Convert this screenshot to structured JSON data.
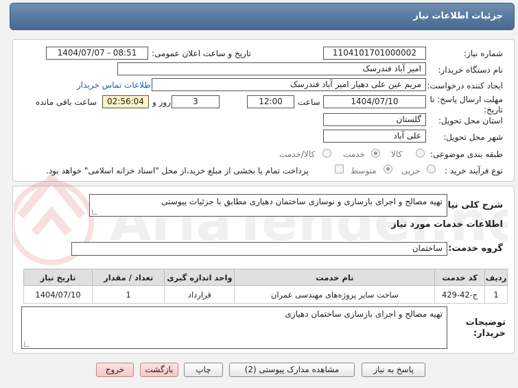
{
  "header": {
    "title": "جزئیات اطلاعات نیاز"
  },
  "form": {
    "need_number_label": "شماره نیاز:",
    "need_number": "1104101701000002",
    "announce_label": "تاریخ و ساعت اعلان عمومی:",
    "announce_value": "1404/07/07 - 08:51",
    "buyer_org_label": "نام دستگاه خریدار:",
    "buyer_org": "امیر آباد فندرسک",
    "creator_label": "ایجاد کننده درخواست:",
    "creator": "مریم عین علی دهیار امیر آباد فندرسک",
    "contact_link": "اطلاعات تماس خریدار",
    "deadline_label": "مهلت ارسال پاسخ: تا تاریخ:",
    "deadline_date": "1404/07/10",
    "time_label": "ساعت",
    "deadline_time": "12:00",
    "days_value": "3",
    "days_label": "روز و",
    "remaining_time": "02:56:04",
    "remaining_label": "ساعت باقی مانده",
    "province_label": "استان محل تحویل:",
    "province": "گلستان",
    "city_label": "شهر محل تحویل:",
    "city": "علی آباد",
    "category_label": "طبقه بندی موضوعی:",
    "category_options": [
      "کالا",
      "خدمت",
      "کالا/خدمت"
    ],
    "process_label": "نوع فرآیند خرید :",
    "process_options": [
      "جزیی",
      "متوسط"
    ],
    "payment_note": "پرداخت تمام یا بخشی از مبلغ خرید،از محل \"اسناد خزانه اسلامی\" خواهد بود."
  },
  "summary": {
    "label": "شرح کلی نیاز:",
    "text": "تهیه مصالح و اجرای بازسازی و نوسازی ساختمان دهیاری مطابق با جزئیات پیوستی"
  },
  "services": {
    "section_title": "اطلاعات خدمات مورد نیاز",
    "group_label": "گروه خدمت:",
    "group_value": "ساختمان",
    "columns": [
      "ردیف",
      "کد خدمت",
      "نام خدمت",
      "واحد اندازه گیری",
      "تعداد / مقدار",
      "تاریخ نیاز"
    ],
    "rows": [
      [
        "1",
        "ج-42-429",
        "ساخت سایر پروژه‌های مهندسی عمران",
        "قرارداد",
        "1",
        "1404/07/10"
      ]
    ]
  },
  "buyer_notes": {
    "label": "توضیحات خریدار:",
    "text": "تهیه مصالح و اجرای بازسازی ساختمان دهیاری"
  },
  "buttons": {
    "reply": "پاسخ به نیاز",
    "view_docs": "مشاهده مدارک پیوستی (2)",
    "print": "چاپ",
    "back": "بازگشت",
    "exit": "خروج"
  },
  "watermark": "AriaTender.net",
  "colors": {
    "header": "#46698f",
    "link": "#1a5fb4",
    "highlight": "#fdf3c4",
    "exit_button": "#f7c7c7"
  }
}
